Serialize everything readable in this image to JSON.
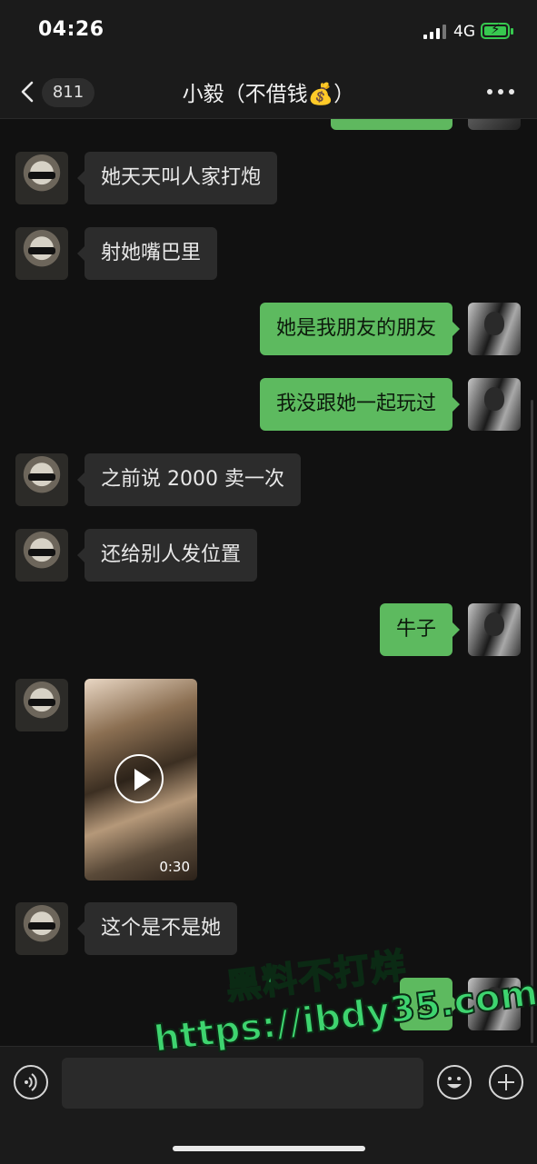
{
  "status_bar": {
    "time": "04:26",
    "network": "4G",
    "battery_icon": "battery-charging-icon"
  },
  "header": {
    "back_icon": "chevron-left-icon",
    "unread_count": "811",
    "title": "小毅（不借钱💰）",
    "more_icon": "more-dots-icon"
  },
  "messages": [
    {
      "side": "other",
      "text": "她天天叫人家打炮"
    },
    {
      "side": "other",
      "text": "射她嘴巴里"
    },
    {
      "side": "self",
      "text": "她是我朋友的朋友"
    },
    {
      "side": "self",
      "text": "我没跟她一起玩过"
    },
    {
      "side": "other",
      "text": "之前说 2000 卖一次"
    },
    {
      "side": "other",
      "text": "还给别人发位置"
    },
    {
      "side": "self",
      "text": "牛子"
    },
    {
      "side": "other",
      "type": "video",
      "duration": "0:30"
    },
    {
      "side": "other",
      "text": "这个是不是她"
    },
    {
      "side": "self",
      "text": "是"
    }
  ],
  "watermark": {
    "line1": "黑料不打烊",
    "line2": "https://ibdy35.com"
  },
  "input_bar": {
    "voice_icon": "voice-icon",
    "emoji_icon": "emoji-icon",
    "plus_icon": "plus-icon",
    "input_value": ""
  },
  "colors": {
    "background": "#111111",
    "bubble_self": "#5dba5f",
    "bubble_other": "#2c2c2c",
    "watermark": "#3ed46f"
  }
}
